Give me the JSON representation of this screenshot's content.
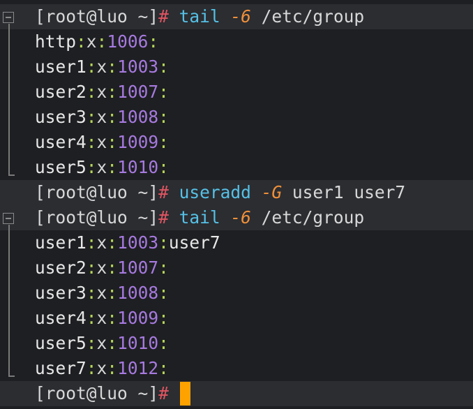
{
  "prompt": {
    "open": "[",
    "user_host": "root@luo",
    "dir": "~",
    "close": "]",
    "symbol": "#"
  },
  "blocks": [
    {
      "command": {
        "name": "tail",
        "option": "-6",
        "arg": "/etc/group"
      },
      "collapsible": true,
      "rows": [
        {
          "name": "http",
          "x": "x",
          "gid": "1006",
          "members": ""
        },
        {
          "name": "user1",
          "x": "x",
          "gid": "1003",
          "members": ""
        },
        {
          "name": "user2",
          "x": "x",
          "gid": "1007",
          "members": ""
        },
        {
          "name": "user3",
          "x": "x",
          "gid": "1008",
          "members": ""
        },
        {
          "name": "user4",
          "x": "x",
          "gid": "1009",
          "members": ""
        },
        {
          "name": "user5",
          "x": "x",
          "gid": "1010",
          "members": ""
        }
      ]
    },
    {
      "command": {
        "name": "useradd",
        "option": "-G",
        "arg": "user1 user7"
      },
      "collapsible": false,
      "rows": []
    },
    {
      "command": {
        "name": "tail",
        "option": "-6",
        "arg": "/etc/group"
      },
      "collapsible": true,
      "rows": [
        {
          "name": "user1",
          "x": "x",
          "gid": "1003",
          "members": "user7"
        },
        {
          "name": "user2",
          "x": "x",
          "gid": "1007",
          "members": ""
        },
        {
          "name": "user3",
          "x": "x",
          "gid": "1008",
          "members": ""
        },
        {
          "name": "user4",
          "x": "x",
          "gid": "1009",
          "members": ""
        },
        {
          "name": "user5",
          "x": "x",
          "gid": "1010",
          "members": ""
        },
        {
          "name": "user7",
          "x": "x",
          "gid": "1012",
          "members": ""
        }
      ]
    }
  ],
  "colors": {
    "background": "#1e1f22",
    "prompt_line_bg": "#2b2d31",
    "hash": "#e05561",
    "command": "#56c1e6",
    "option": "#f0903a",
    "colon": "#b5d65a",
    "gid": "#a77ae0",
    "cursor": "#ffa200"
  },
  "icons": {
    "fold": "collapse-minus-icon"
  }
}
